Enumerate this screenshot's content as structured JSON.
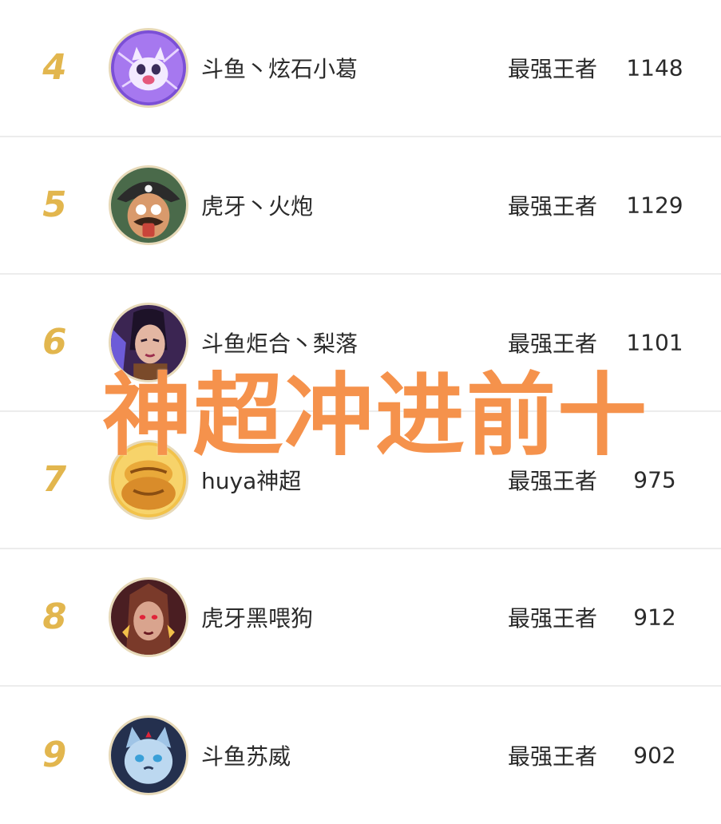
{
  "leaderboard": {
    "rows": [
      {
        "rank": "4",
        "name": "斗鱼丶炫石小葛",
        "tier": "最强王者",
        "score": "1148",
        "avatar_icon": "pink-cat-avatar-icon"
      },
      {
        "rank": "5",
        "name": "虎牙丶火炮",
        "tier": "最强王者",
        "score": "1129",
        "avatar_icon": "pirate-avatar-icon"
      },
      {
        "rank": "6",
        "name": "斗鱼炬合丶梨落",
        "tier": "最强王者",
        "score": "1101",
        "avatar_icon": "sorceress-avatar-icon"
      },
      {
        "rank": "7",
        "name": "huya神超",
        "tier": "最强王者",
        "score": "975",
        "avatar_icon": "golden-toad-avatar-icon"
      },
      {
        "rank": "8",
        "name": "虎牙黑喂狗",
        "tier": "最强王者",
        "score": "912",
        "avatar_icon": "dark-warrior-avatar-icon"
      },
      {
        "rank": "9",
        "name": "斗鱼苏威",
        "tier": "最强王者",
        "score": "902",
        "avatar_icon": "blue-cat-avatar-icon"
      }
    ]
  },
  "overlay": {
    "caption": "神超冲进前十"
  },
  "colors": {
    "rank": "#e2b64e",
    "caption": "#f5924c",
    "text": "#2a2a2a",
    "divider": "#ececec"
  }
}
